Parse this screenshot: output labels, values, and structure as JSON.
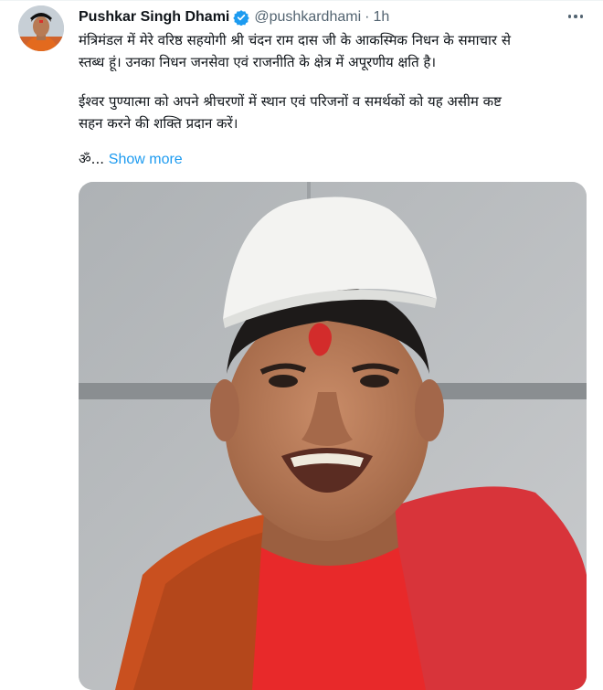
{
  "tweet": {
    "author_name": "Pushkar Singh Dhami",
    "handle": "@pushkardhami",
    "separator": "·",
    "time": "1h",
    "paragraph1_line1": "मंत्रिमंडल में मेरे वरिष्ठ सहयोगी श्री चंदन राम दास जी के आकस्मिक निधन के समाचार से",
    "paragraph1_line2": "स्तब्ध हूं। उनका निधन जनसेवा एवं राजनीति के क्षेत्र में अपूरणीय क्षति है।",
    "paragraph2_line1": "ईश्वर पुण्यात्मा को अपने श्रीचरणों में स्थान एवं परिजनों व समर्थकों को यह असीम कष्ट",
    "paragraph2_line2": "सहन करने की शक्ति प्रदान करें।",
    "paragraph3": "ॐ...",
    "show_more_label": "Show more"
  },
  "icons": {
    "verified": "verified-badge-icon",
    "more": "more-options-icon"
  },
  "colors": {
    "link": "#1d9bf0",
    "verified": "#1d9bf0",
    "secondary_text": "#536471",
    "primary_text": "#0f1419"
  }
}
